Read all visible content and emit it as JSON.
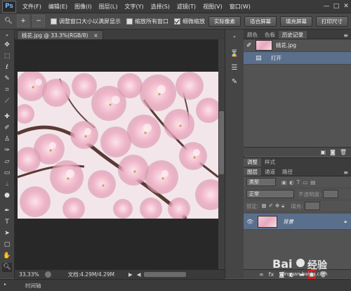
{
  "app": {
    "logo": "Ps"
  },
  "menu": [
    "文件(F)",
    "编辑(E)",
    "图像(I)",
    "图层(L)",
    "文字(Y)",
    "选择(S)",
    "滤镜(T)",
    "视图(V)",
    "窗口(W)"
  ],
  "window_controls": [
    "—",
    "□",
    "✕"
  ],
  "options": {
    "zoom_in": "+",
    "zoom_out": "−",
    "resize_windows": "调整窗口大小以满屏显示",
    "zoom_all": "缩放所有窗口",
    "scrubby_zoom": "细微缩放",
    "actual_pixels": "实际像素",
    "fit_screen": "适合屏幕",
    "fill_screen": "填充屏幕",
    "print_size": "打印尺寸"
  },
  "document": {
    "tab_title": "桃花.jpg @ 33.3%(RGB/8)",
    "close": "×"
  },
  "status": {
    "zoom": "33.33%",
    "doc_info": "文档:4.29M/4.29M"
  },
  "timeline": {
    "label": "时间轴"
  },
  "history_panel": {
    "tabs": [
      "颜色",
      "色板",
      "历史记录"
    ],
    "snapshot_name": "桃花.jpg",
    "steps": [
      "打开"
    ]
  },
  "adjust_tabs": [
    "调整",
    "样式"
  ],
  "layers_panel": {
    "tabs": [
      "图层",
      "通道",
      "路径"
    ],
    "filter_kind": "类型",
    "blend_mode": "正常",
    "opacity_label": "不透明度:",
    "lock_label": "锁定:",
    "fill_label": "填充:",
    "layer_name": "背景"
  },
  "watermark": {
    "brand": "Bai",
    "brand2": "经验",
    "url": "jingyan.baidu.com"
  },
  "colors": {
    "bg": "#535353",
    "menubar": "#3a3a3a",
    "selected": "#5a6f8c",
    "blossom": "#f4c4d4",
    "branch": "#5a3a35"
  }
}
